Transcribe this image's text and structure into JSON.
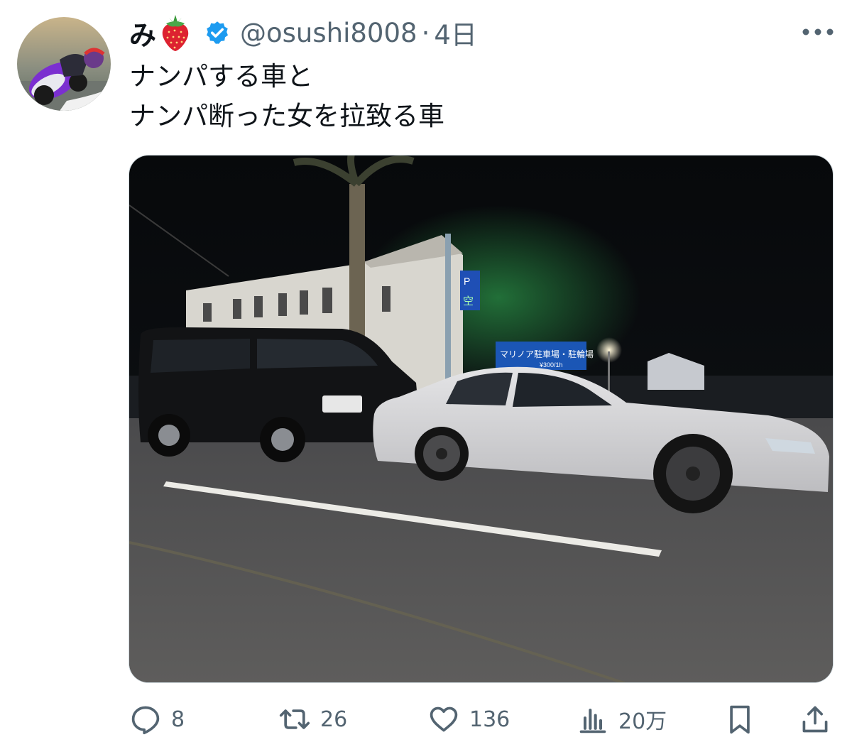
{
  "author": {
    "display_name": "み",
    "emoji_icon": "strawberry-emoji",
    "verified_icon": "verified-badge-icon",
    "handle": "@osushi8008",
    "separator": "·",
    "time": "4日"
  },
  "tweet": {
    "lines": [
      "ナンパする車と",
      "ナンパ断った女を拉致る車"
    ]
  },
  "photo": {
    "sign_text": "マリノア駐車場・駐輪場",
    "sign_subtext": "¥300/1h",
    "parking_sign_letter": "P",
    "parking_sign_status": "空"
  },
  "actions": {
    "reply_count": "8",
    "retweet_count": "26",
    "like_count": "136",
    "views_count": "20万"
  },
  "colors": {
    "text": "#0f1419",
    "secondary": "#536471",
    "verified": "#1d9bf0"
  }
}
